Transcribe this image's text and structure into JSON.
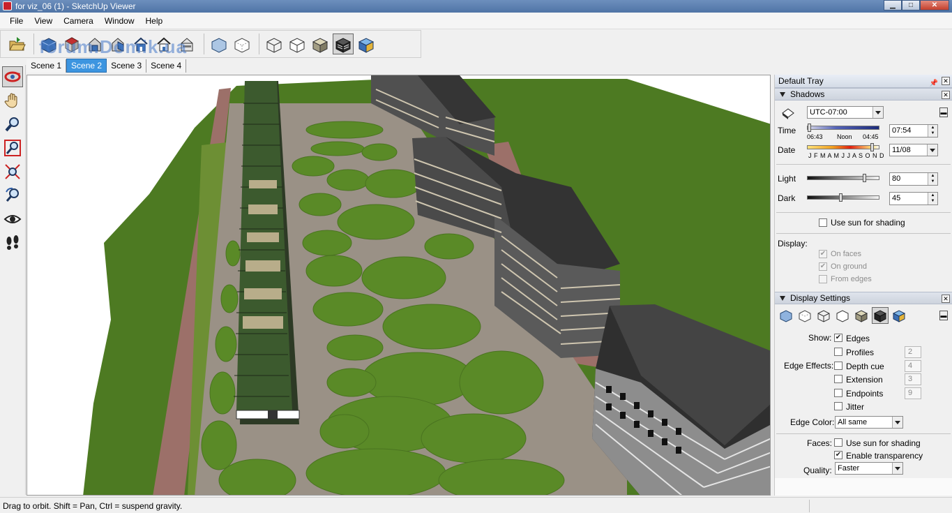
{
  "window": {
    "title": "for viz_06 (1) - SketchUp Viewer"
  },
  "menu": [
    "File",
    "View",
    "Camera",
    "Window",
    "Help"
  ],
  "watermark": "forum.Domik.ua",
  "scenes": [
    {
      "label": "Scene 1",
      "active": false
    },
    {
      "label": "Scene 2",
      "active": true
    },
    {
      "label": "Scene 3",
      "active": false
    },
    {
      "label": "Scene 4",
      "active": false
    }
  ],
  "tray": {
    "title": "Default Tray",
    "shadows": {
      "title": "Shadows",
      "timezone": "UTC-07:00",
      "time_label": "Time",
      "time_scale": {
        "start": "06:43",
        "mid": "Noon",
        "end": "04:45"
      },
      "time_value": "07:54",
      "date_label": "Date",
      "months": "J F M A M J J A S O N D",
      "date_value": "11/08",
      "light_label": "Light",
      "light_value": "80",
      "dark_label": "Dark",
      "dark_value": "45",
      "use_sun": "Use sun for shading",
      "display_label": "Display:",
      "on_faces": "On faces",
      "on_ground": "On ground",
      "from_edges": "From edges"
    },
    "display_settings": {
      "title": "Display Settings",
      "show_label": "Show:",
      "edges": "Edges",
      "edge_effects_label": "Edge Effects:",
      "profiles": "Profiles",
      "profiles_val": "2",
      "depth_cue": "Depth cue",
      "depth_cue_val": "4",
      "extension": "Extension",
      "extension_val": "3",
      "endpoints": "Endpoints",
      "endpoints_val": "9",
      "jitter": "Jitter",
      "edge_color_label": "Edge Color:",
      "edge_color": "All same",
      "faces_label": "Faces:",
      "faces_use_sun": "Use sun for shading",
      "enable_transparency": "Enable transparency",
      "quality_label": "Quality:",
      "quality": "Faster"
    }
  },
  "status": {
    "message": "Drag to orbit. Shift = Pan, Ctrl = suspend gravity."
  },
  "colors": {
    "grass": "#4d7a22",
    "path": "#9a9186",
    "road": "#a0756f",
    "roof": "#3a3a3a",
    "accent": "#3d95e0"
  }
}
